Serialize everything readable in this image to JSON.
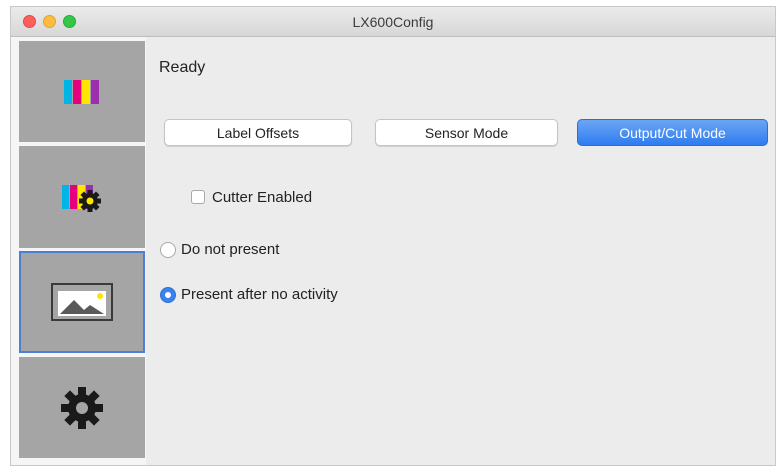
{
  "window": {
    "title": "LX600Config"
  },
  "sidebar": {
    "items": [
      {
        "icon": "color-bars-icon"
      },
      {
        "icon": "color-bars-gear-icon"
      },
      {
        "icon": "label-image-icon",
        "selected": true
      },
      {
        "icon": "gear-icon"
      }
    ]
  },
  "content": {
    "status": "Ready",
    "buttons": {
      "label_offsets": "Label Offsets",
      "sensor_mode": "Sensor Mode",
      "output_cut_mode": "Output/Cut Mode"
    },
    "cutter_enabled": {
      "label": "Cutter Enabled",
      "checked": false
    },
    "presentation": {
      "options": [
        "Do not present",
        "Present after no activity"
      ],
      "selected": "Present after no activity"
    }
  },
  "colors": {
    "accent": "#3b82f0",
    "sidebar_item": "#a5a5a5",
    "selected_border": "#4c7fd3"
  }
}
